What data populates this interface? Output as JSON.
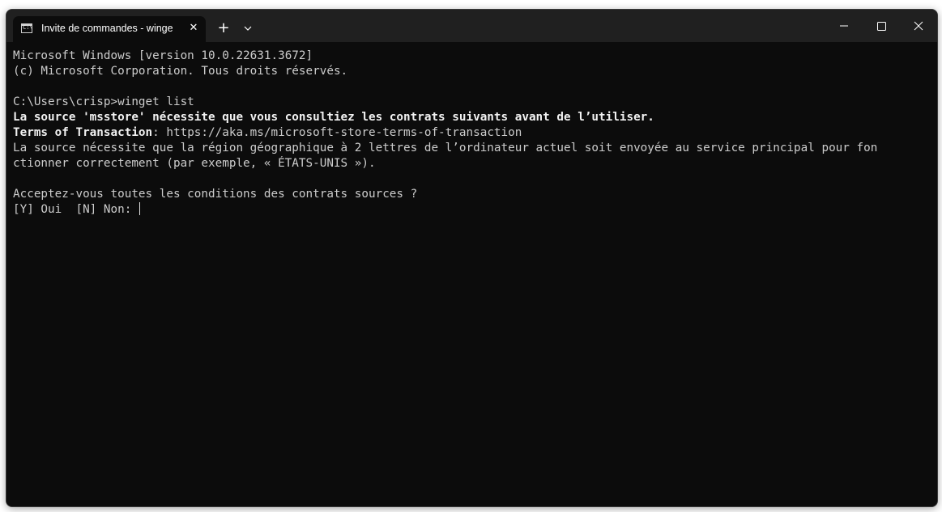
{
  "window": {
    "tab_title": "Invite de commandes - winge",
    "tab_icon_glyph": "C:\\",
    "new_tab_symbol": "+",
    "close_symbol": "✕"
  },
  "terminal": {
    "lines": {
      "l1": "Microsoft Windows [version 10.0.22631.3672]",
      "l2": "(c) Microsoft Corporation. Tous droits réservés.",
      "l3": "",
      "l4": "C:\\Users\\crisp>winget list",
      "l5": "La source 'msstore' nécessite que vous consultiez les contrats suivants avant de l’utiliser.",
      "l6_label": "Terms of Transaction",
      "l6_rest": ": https://aka.ms/microsoft-store-terms-of-transaction",
      "l7": "La source nécessite que la région géographique à 2 lettres de l’ordinateur actuel soit envoyée au service principal pour fon",
      "l8": "ctionner correctement (par exemple, « ÉTATS-UNIS »).",
      "l9": "",
      "l10": "Acceptez-vous toutes les conditions des contrats sources ?",
      "l11": "[Y] Oui  [N] Non: "
    }
  },
  "colors": {
    "terminal_bg": "#0c0c0c",
    "titlebar_bg": "#202020",
    "text": "#cccccc",
    "bold_text": "#f2f2f2"
  },
  "icons": {
    "tab_icon": "command-prompt-icon",
    "tab_close": "close-icon",
    "new_tab": "plus-icon",
    "dropdown": "chevron-down-icon",
    "minimize": "minimize-icon",
    "maximize": "maximize-icon",
    "close": "close-icon"
  }
}
